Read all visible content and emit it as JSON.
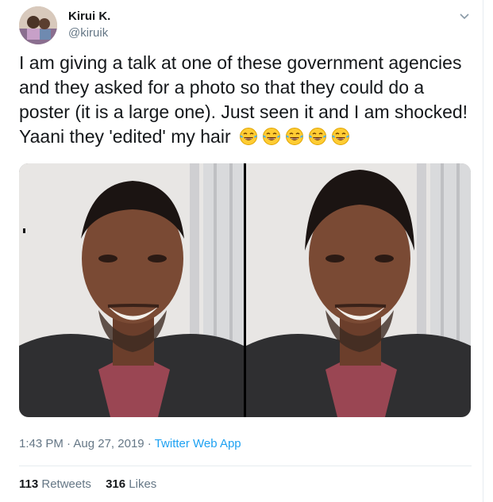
{
  "user": {
    "name": "Kirui K.",
    "handle": "@kiruik"
  },
  "tweet": {
    "text": "I am giving a talk at one of these government agencies and they asked for a photo so that they could do a poster (it is a large one). Just seen it and I am shocked! Yaani they 'edited' my hair",
    "emoji": [
      "face-with-tears-of-joy",
      "face-with-tears-of-joy",
      "face-with-tears-of-joy",
      "face-with-tears-of-joy",
      "face-with-tears-of-joy"
    ]
  },
  "meta": {
    "time": "1:43 PM",
    "dot1": " · ",
    "date": "Aug 27, 2019",
    "dot2": " · ",
    "app": "Twitter Web App"
  },
  "stats": {
    "retweets_count": "113",
    "retweets_label": "Retweets",
    "likes_count": "316",
    "likes_label": "Likes"
  },
  "colors": {
    "link": "#1da1f2",
    "secondary_text": "#657786",
    "primary_text": "#14171a",
    "divider": "#e6ecf0"
  }
}
